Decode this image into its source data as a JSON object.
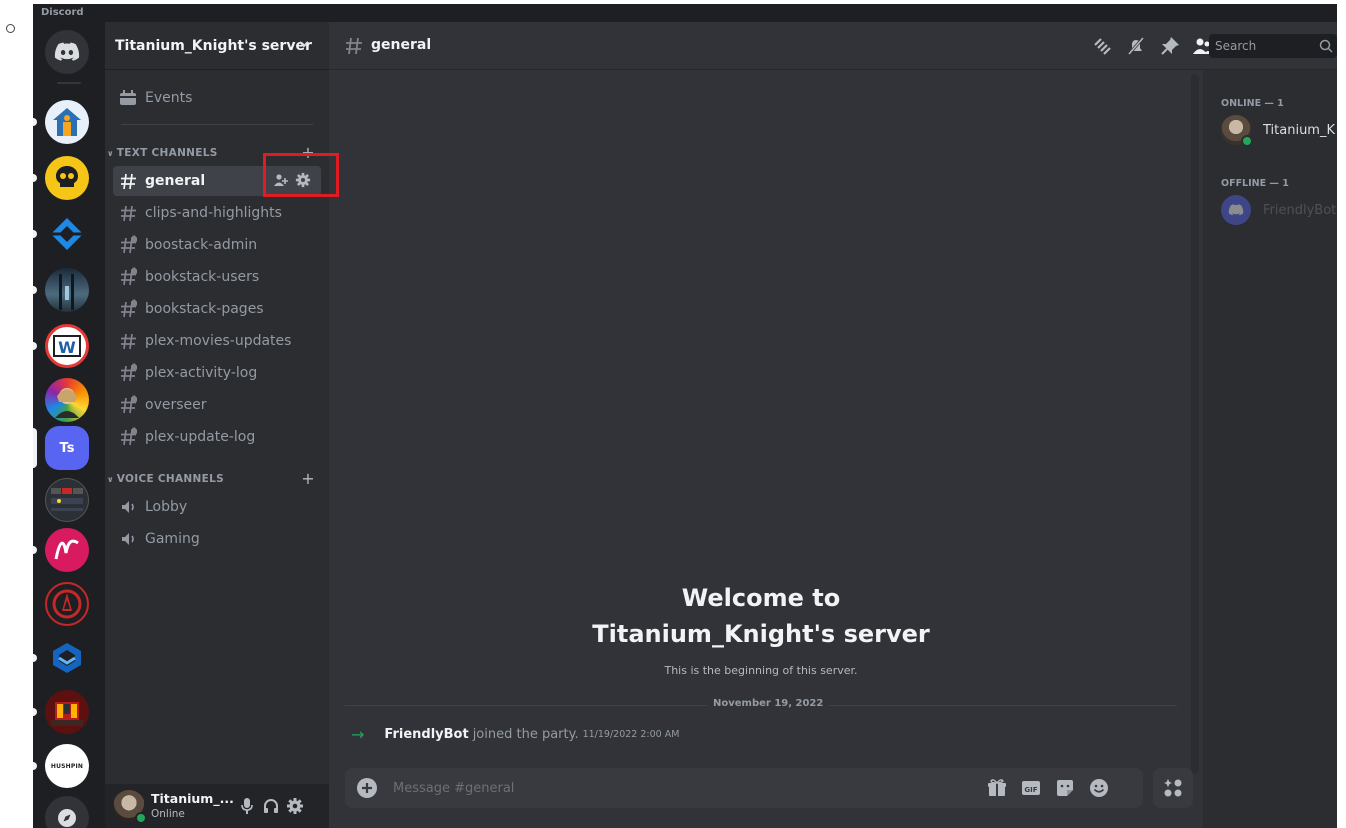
{
  "window": {
    "brand": "Discord"
  },
  "colors": {
    "accent": "#5865f2",
    "online": "#23a55a",
    "highlight": "#e01b22"
  },
  "servers": [
    {
      "name": "home-icon"
    },
    {
      "name": "skull-server"
    },
    {
      "name": "diamond-server"
    },
    {
      "name": "forest-server"
    },
    {
      "name": "w-server"
    },
    {
      "name": "portrait-server"
    },
    {
      "name": "ts-server",
      "label": "Ts"
    },
    {
      "name": "calendar-server"
    },
    {
      "name": "script-server"
    },
    {
      "name": "red-ring-server"
    },
    {
      "name": "blue-hex-server"
    },
    {
      "name": "cinema-server"
    },
    {
      "name": "hushpin-server",
      "label": "HUSHPIN"
    }
  ],
  "sidebar": {
    "server_name": "Titanium_Knight's server",
    "events_label": "Events",
    "text_category": "TEXT CHANNELS",
    "voice_category": "VOICE CHANNELS",
    "text_channels": [
      {
        "label": "general",
        "active": true
      },
      {
        "label": "clips-and-highlights"
      },
      {
        "label": "boostack-admin",
        "locked": true
      },
      {
        "label": "bookstack-users",
        "locked": true
      },
      {
        "label": "bookstack-pages",
        "locked": true
      },
      {
        "label": "plex-movies-updates"
      },
      {
        "label": "plex-activity-log",
        "locked": true
      },
      {
        "label": "overseer",
        "locked": true
      },
      {
        "label": "plex-update-log",
        "locked": true
      }
    ],
    "voice_channels": [
      {
        "label": "Lobby"
      },
      {
        "label": "Gaming"
      }
    ]
  },
  "user": {
    "name": "Titanium_...",
    "status": "Online"
  },
  "header": {
    "channel": "general",
    "search_placeholder": "Search"
  },
  "messages": {
    "welcome_line1": "Welcome to",
    "welcome_line2": "Titanium_Knight's server",
    "beginning": "This is the beginning of this server.",
    "date": "November 19, 2022",
    "join_user": "FriendlyBot",
    "join_text": "joined the party.",
    "join_time": "11/19/2022 2:00 AM"
  },
  "composer": {
    "placeholder": "Message #general"
  },
  "members": {
    "online_header": "ONLINE — 1",
    "offline_header": "OFFLINE — 1",
    "online": [
      {
        "name": "Titanium_K"
      }
    ],
    "offline": [
      {
        "name": "FriendlyBot"
      }
    ]
  }
}
